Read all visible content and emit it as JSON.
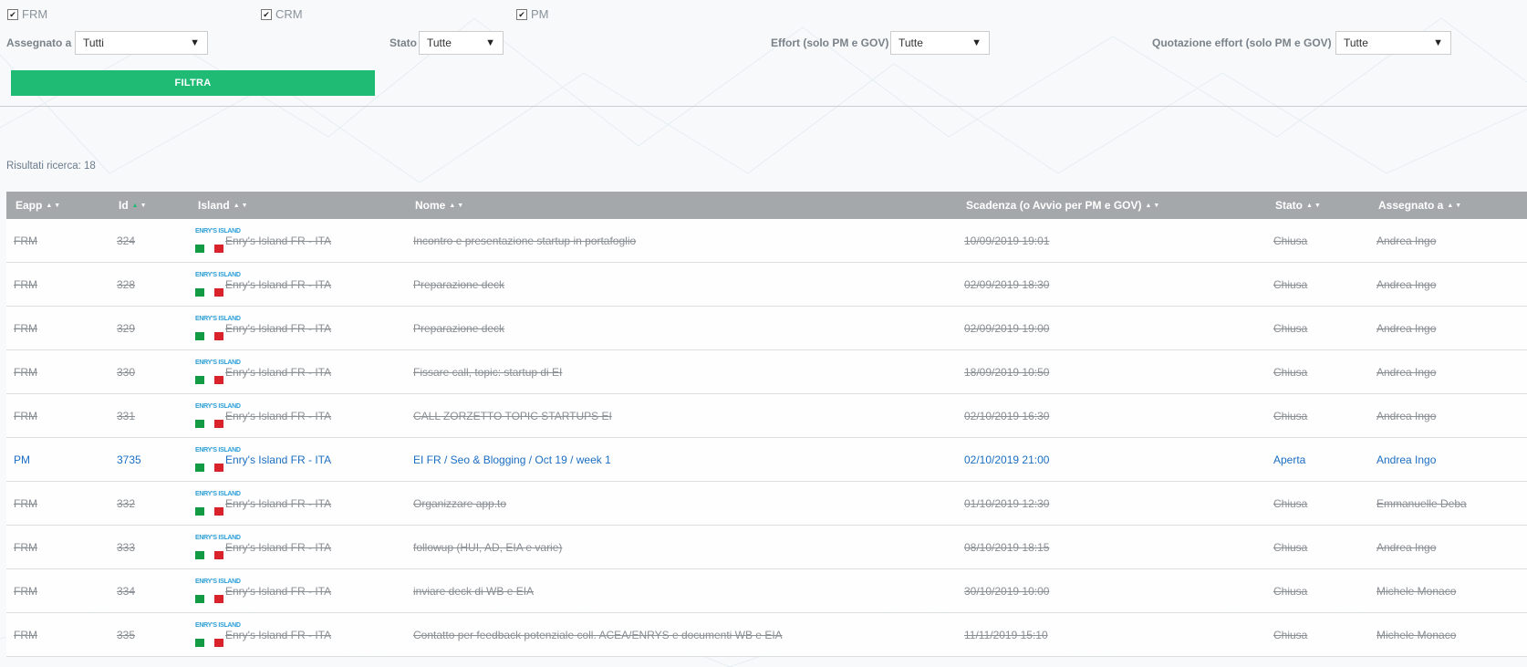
{
  "checkboxes": [
    {
      "label": "FRM",
      "checked": true
    },
    {
      "label": "CRM",
      "checked": true
    },
    {
      "label": "PM",
      "checked": true
    }
  ],
  "filters": {
    "assegnato": {
      "label": "Assegnato a",
      "value": "Tutti"
    },
    "stato": {
      "label": "Stato",
      "value": "Tutte"
    },
    "effort": {
      "label": "Effort (solo PM e GOV)",
      "value": "Tutte"
    },
    "quotazione": {
      "label": "Quotazione effort (solo PM e GOV)",
      "value": "Tutte"
    },
    "button_label": "FILTRA"
  },
  "results_text": "Risultati ricerca: 18",
  "colors": {
    "accent": "#1fba74",
    "header_bg": "#a5a8ab",
    "open_text": "#1b6ec2",
    "closed_text": "#8a8f94"
  },
  "table": {
    "columns": [
      "Eapp",
      "Id",
      "Island",
      "Nome",
      "Scadenza (o Avvio per PM e GOV)",
      "Stato",
      "Assegnato a"
    ],
    "sorted_column": "Id",
    "logo_text": "ENRY'S ISLAND",
    "rows": [
      {
        "eapp": "FRM",
        "id": "324",
        "island": "Enry's Island FR - ITA",
        "nome": "Incontro e presentazione startup in portafoglio",
        "scadenza": "10/09/2019 19:01",
        "stato": "Chiusa",
        "assegnato": "Andrea Ingo",
        "closed": true
      },
      {
        "eapp": "FRM",
        "id": "328",
        "island": "Enry's Island FR - ITA",
        "nome": "Preparazione deck",
        "scadenza": "02/09/2019 18:30",
        "stato": "Chiusa",
        "assegnato": "Andrea Ingo",
        "closed": true
      },
      {
        "eapp": "FRM",
        "id": "329",
        "island": "Enry's Island FR - ITA",
        "nome": "Preparazione deck",
        "scadenza": "02/09/2019 19:00",
        "stato": "Chiusa",
        "assegnato": "Andrea Ingo",
        "closed": true
      },
      {
        "eapp": "FRM",
        "id": "330",
        "island": "Enry's Island FR - ITA",
        "nome": "Fissare call, topic: startup di EI",
        "scadenza": "18/09/2019 10:50",
        "stato": "Chiusa",
        "assegnato": "Andrea Ingo",
        "closed": true
      },
      {
        "eapp": "FRM",
        "id": "331",
        "island": "Enry's Island FR - ITA",
        "nome": "CALL ZORZETTO TOPIC STARTUPS EI",
        "scadenza": "02/10/2019 16:30",
        "stato": "Chiusa",
        "assegnato": "Andrea Ingo",
        "closed": true
      },
      {
        "eapp": "PM",
        "id": "3735",
        "island": "Enry's Island FR - ITA",
        "nome": "EI FR / Seo & Blogging / Oct 19 / week 1",
        "scadenza": "02/10/2019 21:00",
        "stato": "Aperta",
        "assegnato": "Andrea Ingo",
        "closed": false
      },
      {
        "eapp": "FRM",
        "id": "332",
        "island": "Enry's Island FR - ITA",
        "nome": "Organizzare app.to",
        "scadenza": "01/10/2019 12:30",
        "stato": "Chiusa",
        "assegnato": "Emmanuelle Deba",
        "closed": true
      },
      {
        "eapp": "FRM",
        "id": "333",
        "island": "Enry's Island FR - ITA",
        "nome": "followup (HUI, AD, EIA e varie)",
        "scadenza": "08/10/2019 18:15",
        "stato": "Chiusa",
        "assegnato": "Andrea Ingo",
        "closed": true
      },
      {
        "eapp": "FRM",
        "id": "334",
        "island": "Enry's Island FR - ITA",
        "nome": "inviare deck di WB e EIA",
        "scadenza": "30/10/2019 10:00",
        "stato": "Chiusa",
        "assegnato": "Michele Monaco",
        "closed": true
      },
      {
        "eapp": "FRM",
        "id": "335",
        "island": "Enry's Island FR - ITA",
        "nome": "Contatto per feedback potenziale coll. ACEA/ENRYS e documenti WB e EIA",
        "scadenza": "11/11/2019 15:10",
        "stato": "Chiusa",
        "assegnato": "Michele Monaco",
        "closed": true
      }
    ]
  }
}
